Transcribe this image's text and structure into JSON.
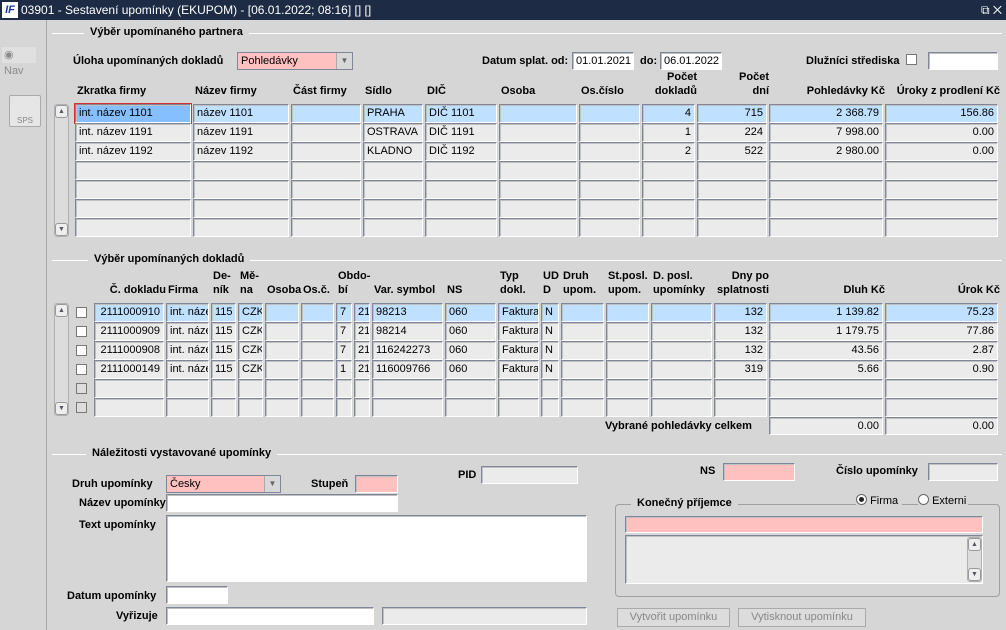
{
  "window": {
    "title": "03901 - Sestavení upomínky (EKUPOM) - [06.01.2022; 08:16]  [] []",
    "logo": "IF",
    "controls": "⧉ ✕"
  },
  "nav": {
    "nav_label": "Nav",
    "sps_label": "SPS"
  },
  "partner": {
    "section_title": "Výběr upomínaného partnera",
    "uloha_label": "Úloha upomínaných dokladů",
    "uloha_value": "Pohledávky",
    "datum_od_label": "Datum splat. od:",
    "datum_od": "01.01.2021",
    "datum_do_label": "do:",
    "datum_do": "06.01.2022",
    "strediska_label": "Dlužníci střediska",
    "strediska_value": "",
    "columns": [
      "Zkratka firmy",
      "Název firmy",
      "Část firmy",
      "Sídlo",
      "DIČ",
      "Osoba",
      "Os.číslo",
      "Počet\ndokladů",
      "Počet\ndní",
      "Pohledávky Kč",
      "Úroky z prodlení Kč"
    ],
    "rows": [
      [
        "int. název 1101",
        "název 1101",
        "",
        "PRAHA",
        "DIČ 1101",
        "",
        "",
        "4",
        "715",
        "2 368.79",
        "156.86"
      ],
      [
        "int. název 1191",
        "název 1191",
        "",
        "OSTRAVA",
        "DIČ 1191",
        "",
        "",
        "1",
        "224",
        "7 998.00",
        "0.00"
      ],
      [
        "int. název 1192",
        "název 1192",
        "",
        "KLADNO",
        "DIČ 1192",
        "",
        "",
        "2",
        "522",
        "2 980.00",
        "0.00"
      ],
      [
        "",
        "",
        "",
        "",
        "",
        "",
        "",
        "",
        "",
        "",
        ""
      ],
      [
        "",
        "",
        "",
        "",
        "",
        "",
        "",
        "",
        "",
        "",
        ""
      ],
      [
        "",
        "",
        "",
        "",
        "",
        "",
        "",
        "",
        "",
        "",
        ""
      ],
      [
        "",
        "",
        "",
        "",
        "",
        "",
        "",
        "",
        "",
        "",
        ""
      ]
    ]
  },
  "docs": {
    "section_title": "Výběr upomínaných dokladů",
    "columns": [
      "Č. dokladu",
      "Firma",
      "De-\nník",
      "Mě-\nna",
      "Osoba",
      "Os.č.",
      "Obdo-\nbí",
      "",
      "Var. symbol",
      "NS",
      "Typ\ndokl.",
      "UD\nD",
      "Druh\nupom.",
      "St.posl.\nupom.",
      "D. posl.\nupomínky",
      "Dny po\nsplatnosti",
      "Dluh Kč",
      "Úrok Kč"
    ],
    "rows": [
      [
        "2111000910",
        "int. náze",
        "115",
        "CZK",
        "",
        "",
        "7",
        "21",
        "98213",
        "060",
        "Faktura",
        "N",
        "",
        "",
        "",
        "132",
        "1 139.82",
        "75.23"
      ],
      [
        "2111000909",
        "int. náze",
        "115",
        "CZK",
        "",
        "",
        "7",
        "21",
        "98214",
        "060",
        "Faktura",
        "N",
        "",
        "",
        "",
        "132",
        "1 179.75",
        "77.86"
      ],
      [
        "2111000908",
        "int. náze",
        "115",
        "CZK",
        "",
        "",
        "7",
        "21",
        "116242273",
        "060",
        "Faktura",
        "N",
        "",
        "",
        "",
        "132",
        "43.56",
        "2.87"
      ],
      [
        "2111000149",
        "int. náze",
        "115",
        "CZK",
        "",
        "",
        "1",
        "21",
        "116009766",
        "060",
        "Faktura",
        "N",
        "",
        "",
        "",
        "319",
        "5.66",
        "0.90"
      ],
      [
        "",
        "",
        "",
        "",
        "",
        "",
        "",
        "",
        "",
        "",
        "",
        "",
        "",
        "",
        "",
        "",
        "",
        ""
      ],
      [
        "",
        "",
        "",
        "",
        "",
        "",
        "",
        "",
        "",
        "",
        "",
        "",
        "",
        "",
        "",
        "",
        "",
        ""
      ]
    ],
    "total_label": "Vybrané pohledávky celkem",
    "total_dluh": "0.00",
    "total_urok": "0.00"
  },
  "reminder": {
    "section_title": "Náležitosti vystavované upomínky",
    "druh_label": "Druh upomínky",
    "druh_value": "Česky",
    "stupen_label": "Stupeň",
    "pid_label": "PID",
    "ns_label": "NS",
    "cislo_label": "Číslo upomínky",
    "nazev_label": "Název upomínky",
    "text_label": "Text upomínky",
    "datum_label": "Datum upomínky",
    "vyrizuje_label": "Vyřizuje",
    "recipient_title": "Konečný příjemce",
    "radio_firma": "Firma",
    "radio_externi": "Externi",
    "selected_radio": "Firma",
    "create_button": "Vytvořit upomínku",
    "print_button": "Vytisknout upomínku"
  }
}
